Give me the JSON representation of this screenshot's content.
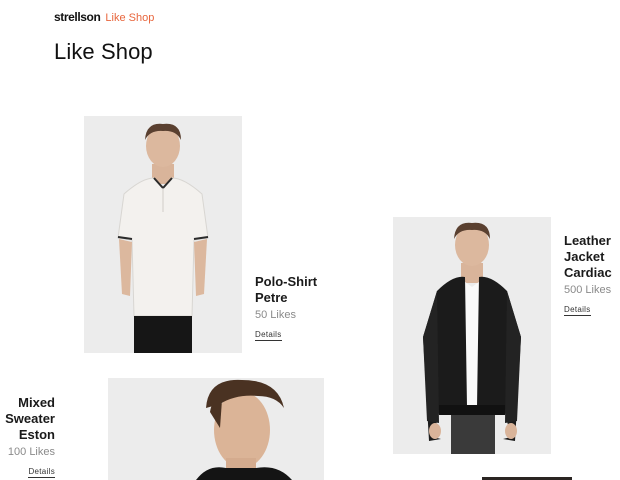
{
  "header": {
    "brand_logo": "strellson",
    "brand_section": "Like Shop",
    "title": "Like Shop"
  },
  "products": [
    {
      "name_lines": [
        "Polo-Shirt",
        "Petre"
      ],
      "likes": "50 Likes",
      "details_label": "Details",
      "image_icon": "polo-shirt-model-photo"
    },
    {
      "name_lines": [
        "Leather",
        "Jacket",
        "Cardiac"
      ],
      "likes": "500 Likes",
      "details_label": "Details",
      "image_icon": "leather-jacket-model-photo"
    },
    {
      "name_lines": [
        "Mixed",
        "Sweater",
        "Eston"
      ],
      "likes": "100 Likes",
      "details_label": "Details",
      "image_icon": "sweater-model-photo"
    }
  ],
  "colors": {
    "accent": "#e8663d",
    "text": "#1a1a1a",
    "muted": "#8a8a8a",
    "image_bg": "#eeeeee"
  }
}
